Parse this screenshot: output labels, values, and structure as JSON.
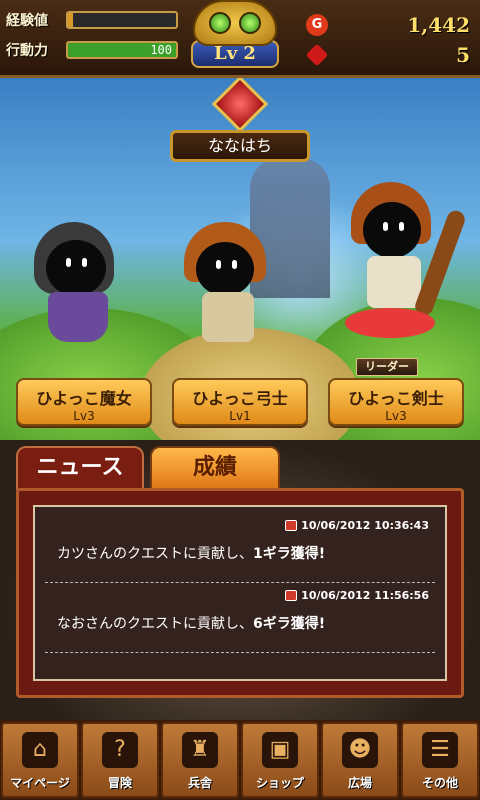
{
  "header": {
    "exp_label": "経験値",
    "exp_fraction": 0.05,
    "action_label": "行動力",
    "action_value": "100",
    "action_fraction": 1.0,
    "level": "Lv 2",
    "gold_icon": "G",
    "gold_value": "1,442",
    "gem_value": "5"
  },
  "scene": {
    "player_name": "ななはち",
    "leader_tag": "リーダー",
    "characters": [
      {
        "name": "ひよっこ魔女",
        "level": "Lv3"
      },
      {
        "name": "ひよっこ弓士",
        "level": "Lv1"
      },
      {
        "name": "ひよっこ剣士",
        "level": "Lv3"
      }
    ]
  },
  "tabs": {
    "news": "ニュース",
    "results": "成績"
  },
  "news": [
    {
      "timestamp": "10/06/2012 10:36:43",
      "prefix": "カツさんのクエストに貢献し、",
      "amount": "1ギラ獲得!"
    },
    {
      "timestamp": "10/06/2012 11:56:56",
      "prefix": "なおさんのクエストに貢献し、",
      "amount": "6ギラ獲得!"
    }
  ],
  "nav": [
    {
      "label": "マイページ",
      "icon": "home-icon"
    },
    {
      "label": "冒険",
      "icon": "question-icon"
    },
    {
      "label": "兵舎",
      "icon": "helmet-icon"
    },
    {
      "label": "ショップ",
      "icon": "chest-icon"
    },
    {
      "label": "広場",
      "icon": "people-icon"
    },
    {
      "label": "その他",
      "icon": "menu-icon"
    }
  ],
  "colors": {
    "exp_bar": "#d99a2a",
    "action_bar": "#3aa02a",
    "gold_icon": "#e03a1a",
    "gem_icon": "#d01a1a"
  }
}
